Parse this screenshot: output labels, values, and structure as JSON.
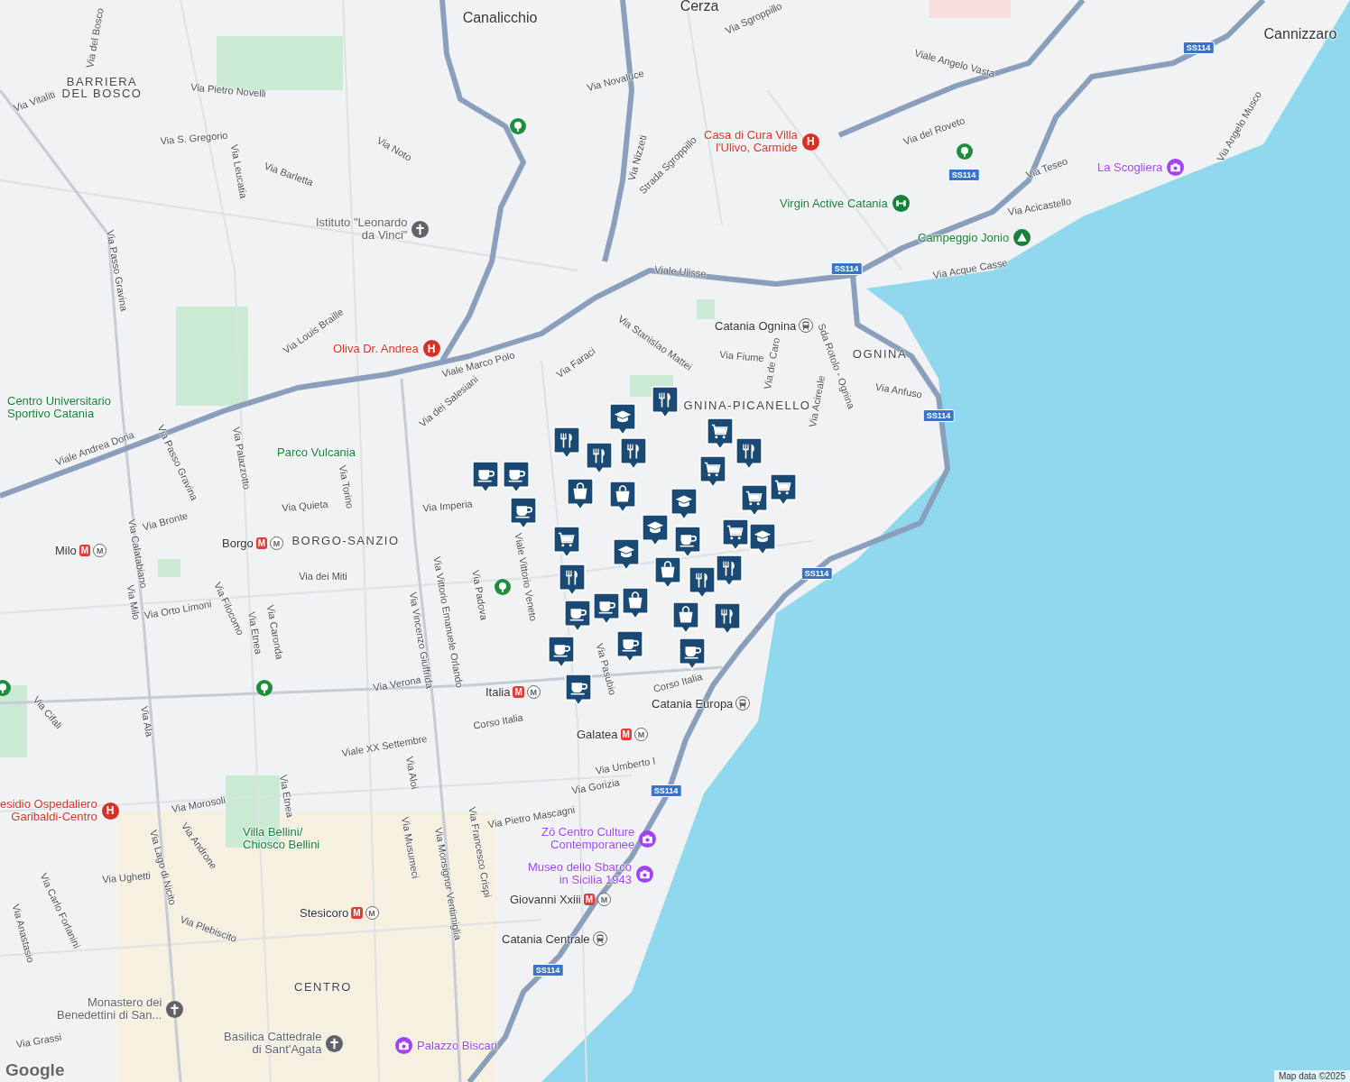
{
  "map": {
    "districts": [
      {
        "text": "BARRIERA"
      },
      {
        "text": "DEL BOSCO"
      },
      {
        "text": "BORGO-SANZIO"
      },
      {
        "text": "OGNINA"
      },
      {
        "text": "GNINA-PICANELLO"
      },
      {
        "text": "CENTRO"
      }
    ],
    "places": [
      {
        "text": "Canalicchio"
      },
      {
        "text": "Cerza"
      },
      {
        "text": "Cannizzaro"
      }
    ],
    "roads": [
      {
        "text": "Via del Bosco"
      },
      {
        "text": "Via Vitaliti"
      },
      {
        "text": "Via Pietro Novelli"
      },
      {
        "text": "Via S. Gregorio"
      },
      {
        "text": "Via Leucatia"
      },
      {
        "text": "Via Noto"
      },
      {
        "text": "Via Barletta"
      },
      {
        "text": "Via Passo Gravina"
      },
      {
        "text": "Via Louis Braille"
      },
      {
        "text": "Via Novaluce"
      },
      {
        "text": "Via Sgroppillo"
      },
      {
        "text": "Via Nizzeti"
      },
      {
        "text": "Strada Sgroppillo"
      },
      {
        "text": "Viale Angelo Vasta"
      },
      {
        "text": "Via del Roveto"
      },
      {
        "text": "Via Teseo"
      },
      {
        "text": "Via Angelo Musco"
      },
      {
        "text": "Via Acicastello"
      },
      {
        "text": "Via Acque Casse"
      },
      {
        "text": "Viale Ulisse"
      },
      {
        "text": "Via Stanislao Mattei"
      },
      {
        "text": "Via Fiume"
      },
      {
        "text": "Via de Caro"
      },
      {
        "text": "Sda Rotolo - Ognina"
      },
      {
        "text": "Via Acireale"
      },
      {
        "text": "Via Anfuso"
      },
      {
        "text": "Via Faraci"
      },
      {
        "text": "Viale Marco Polo"
      },
      {
        "text": "Via dei Salesiani"
      },
      {
        "text": "Viale Andrea Doria"
      },
      {
        "text": "Via Passo Gravina"
      },
      {
        "text": "Via Palazzotto"
      },
      {
        "text": "Via Torino"
      },
      {
        "text": "Via Quieta"
      },
      {
        "text": "Via Imperia"
      },
      {
        "text": "Via Bronte"
      },
      {
        "text": "Via Calatabiano"
      },
      {
        "text": "Via dei Miti"
      },
      {
        "text": "Via Orto Limoni"
      },
      {
        "text": "Via Milo"
      },
      {
        "text": "Via Filocomo"
      },
      {
        "text": "Via Etnea"
      },
      {
        "text": "Via Caronda"
      },
      {
        "text": "Via Vincenzo Giuffrida"
      },
      {
        "text": "Via Vittorio Emanuele Orlando"
      },
      {
        "text": "Via Padova"
      },
      {
        "text": "Viale Vittorio Veneto"
      },
      {
        "text": "Via Verona"
      },
      {
        "text": "Via Pasubio"
      },
      {
        "text": "Corso Italia"
      },
      {
        "text": "Via Cifali"
      },
      {
        "text": "Via Ala"
      },
      {
        "text": "Corso Italia"
      },
      {
        "text": "Viale XX Settembre"
      },
      {
        "text": "Via Aloi"
      },
      {
        "text": "Via Umberto I"
      },
      {
        "text": "Via Gorizia"
      },
      {
        "text": "Via Etnea"
      },
      {
        "text": "Via Morosoli"
      },
      {
        "text": "Via Androne"
      },
      {
        "text": "Via Pietro Mascagni"
      },
      {
        "text": "Via Monsignor Ventimiglia"
      },
      {
        "text": "Via Francesco Crispi"
      },
      {
        "text": "Via Musumeci"
      },
      {
        "text": "Via Lago di Nicito"
      },
      {
        "text": "Via Ughetti"
      },
      {
        "text": "Via Carlo Forlanini"
      },
      {
        "text": "Via Anastasio"
      },
      {
        "text": "Via Plebiscito"
      },
      {
        "text": "Via Grassi"
      }
    ],
    "highway_shields": [
      {
        "text": "SS114"
      },
      {
        "text": "SS114"
      },
      {
        "text": "SS114"
      },
      {
        "text": "SS114"
      },
      {
        "text": "SS114"
      },
      {
        "text": "SS114"
      },
      {
        "text": "SS114"
      }
    ],
    "pois": [
      {
        "kind": "hospital",
        "lines": [
          "Casa di Cura Villa",
          "l'Ulivo, Carmide"
        ],
        "sign": "H"
      },
      {
        "kind": "worship",
        "lines": [
          "Istituto \"Leonardo",
          "da Vinci\""
        ]
      },
      {
        "kind": "hospital",
        "lines": [
          "Oliva Dr. Andrea"
        ],
        "sign": "H"
      },
      {
        "kind": "park",
        "lines": [
          "Centro Universitario",
          "Sportivo Catania"
        ]
      },
      {
        "kind": "park",
        "lines": [
          "Parco Vulcania"
        ]
      },
      {
        "kind": "gym",
        "lines": [
          "Virgin Active Catania"
        ]
      },
      {
        "kind": "camping",
        "lines": [
          "Campeggio Jonio"
        ]
      },
      {
        "kind": "museum",
        "lines": [
          "La Scogliera"
        ]
      },
      {
        "kind": "museum",
        "lines": [
          "Zō Centro Culture",
          "Contemporanee"
        ]
      },
      {
        "kind": "museum",
        "lines": [
          "Museo dello Sbarco",
          "in Sicilia 1943"
        ]
      },
      {
        "kind": "hospital",
        "lines": [
          "esidio Ospedaliero",
          "Garibaldi-Centro"
        ],
        "sign": "H"
      },
      {
        "kind": "park",
        "lines": [
          "Villa Bellini/",
          "Chiosco Bellini"
        ]
      },
      {
        "kind": "worship",
        "lines": [
          "Monastero dei",
          "Benedettini di San..."
        ]
      },
      {
        "kind": "worship",
        "lines": [
          "Basilica Cattedrale",
          "di Sant'Agata"
        ]
      },
      {
        "kind": "museum",
        "lines": [
          "Palazzo Biscari"
        ]
      }
    ],
    "stations": [
      {
        "kind": "train",
        "name": "Catania Ognina"
      },
      {
        "kind": "metro",
        "name": "Milo",
        "signs": [
          "M",
          "M"
        ]
      },
      {
        "kind": "metro",
        "name": "Borgo",
        "signs": [
          "M",
          "M"
        ]
      },
      {
        "kind": "metro",
        "name": "Italia",
        "signs": [
          "M",
          "M"
        ]
      },
      {
        "kind": "metro",
        "name": "Galatea",
        "signs": [
          "M",
          "M"
        ]
      },
      {
        "kind": "metro",
        "name": "Stesicoro",
        "signs": [
          "M",
          "M"
        ]
      },
      {
        "kind": "metro",
        "name": "Giovanni Xxiii",
        "signs": [
          "M",
          "M"
        ]
      },
      {
        "kind": "train",
        "name": "Catania Europa"
      },
      {
        "kind": "train",
        "name": "Catania Centrale"
      }
    ],
    "markers": [
      {
        "kind": "cafe"
      },
      {
        "kind": "cafe"
      },
      {
        "kind": "cafe"
      },
      {
        "kind": "cafe"
      },
      {
        "kind": "cafe"
      },
      {
        "kind": "cafe"
      },
      {
        "kind": "cafe"
      },
      {
        "kind": "cafe"
      },
      {
        "kind": "cafe"
      },
      {
        "kind": "cafe"
      },
      {
        "kind": "restaurant"
      },
      {
        "kind": "restaurant"
      },
      {
        "kind": "restaurant"
      },
      {
        "kind": "restaurant"
      },
      {
        "kind": "restaurant"
      },
      {
        "kind": "restaurant"
      },
      {
        "kind": "restaurant"
      },
      {
        "kind": "restaurant"
      },
      {
        "kind": "restaurant"
      },
      {
        "kind": "shop"
      },
      {
        "kind": "shop"
      },
      {
        "kind": "shop"
      },
      {
        "kind": "shop"
      },
      {
        "kind": "shop"
      },
      {
        "kind": "grocery"
      },
      {
        "kind": "grocery"
      },
      {
        "kind": "grocery"
      },
      {
        "kind": "grocery"
      },
      {
        "kind": "grocery"
      },
      {
        "kind": "grocery"
      },
      {
        "kind": "school"
      },
      {
        "kind": "school"
      },
      {
        "kind": "school"
      },
      {
        "kind": "school"
      },
      {
        "kind": "school"
      }
    ]
  },
  "logo": "Google",
  "attribution": "Map data ©2025"
}
